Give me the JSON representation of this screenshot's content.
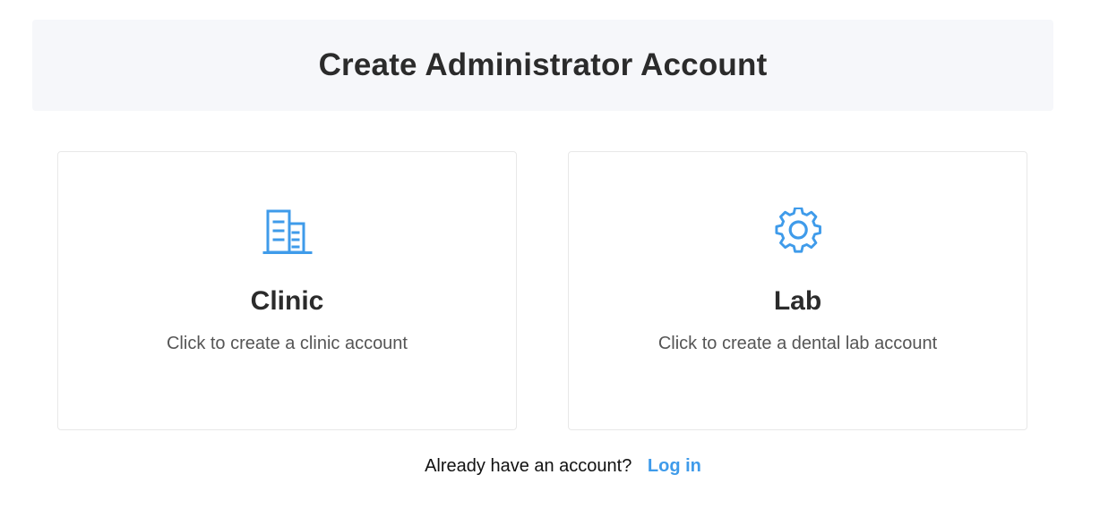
{
  "header": {
    "title": "Create Administrator Account"
  },
  "cards": {
    "clinic": {
      "icon": "building-icon",
      "title": "Clinic",
      "description": "Click to create a clinic account"
    },
    "lab": {
      "icon": "gear-icon",
      "title": "Lab",
      "description": "Click to create a dental lab account"
    }
  },
  "footer": {
    "prompt": "Already have an account?",
    "login_label": "Log in"
  },
  "colors": {
    "accent": "#3f9bea",
    "heading": "#2b2b2b",
    "header_bg": "#f6f7fa"
  }
}
